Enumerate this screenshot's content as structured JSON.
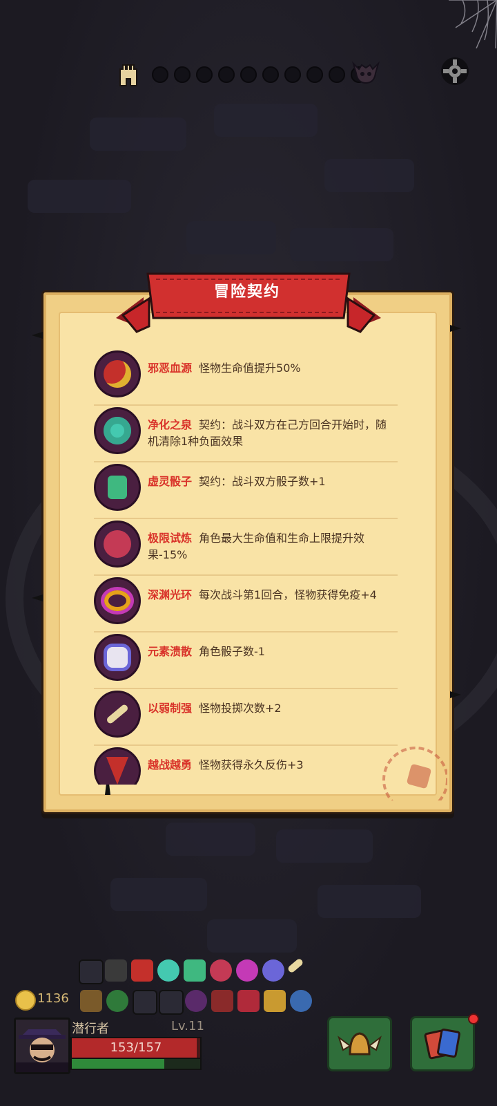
{
  "header": {
    "progress_nodes": 10,
    "icons": [
      "castle-icon",
      "boss-skull-icon",
      "gear-icon",
      "cobweb-icon"
    ]
  },
  "panel": {
    "title": "冒险契约",
    "contracts": [
      {
        "name": "邪恶血源",
        "desc": "怪物生命值提升50%",
        "icon": "blood-chalice-icon",
        "color": "#c4302b"
      },
      {
        "name": "净化之泉",
        "desc": "契约：战斗双方在己方回合开始时，随机清除1种负面效果",
        "icon": "purify-spring-icon",
        "color": "#44c9b0"
      },
      {
        "name": "虚灵骰子",
        "desc": "契约：战斗双方骰子数+1",
        "icon": "ghost-dice-icon",
        "color": "#3fb880"
      },
      {
        "name": "极限试炼",
        "desc": "角色最大生命值和生命上限提升效果-15%",
        "icon": "heart-lock-icon",
        "color": "#c43a55"
      },
      {
        "name": "深渊光环",
        "desc": "每次战斗第1回合，怪物获得免疫+4",
        "icon": "abyss-halo-icon",
        "color": "#c43ab6"
      },
      {
        "name": "元素溃散",
        "desc": "角色骰子数-1",
        "icon": "broken-dice-icon",
        "color": "#6b66d8"
      },
      {
        "name": "以弱制强",
        "desc": "怪物投掷次数+2",
        "icon": "bone-icon",
        "color": "#e8d8a0"
      },
      {
        "name": "越战越勇",
        "desc": "怪物获得永久反伤+3",
        "icon": "thorn-shield-icon",
        "color": "#c4302b"
      }
    ]
  },
  "player": {
    "coins": "1136",
    "name": "潜行者",
    "level": "Lv.11",
    "hp_text": "153/157",
    "hp_fraction": 0.975,
    "xp_fraction": 0.72
  },
  "colors": {
    "background": "#1e1c24",
    "scroll": "#f9e3a6",
    "ribbon": "#c7262a",
    "contract_name": "#d9332a"
  }
}
